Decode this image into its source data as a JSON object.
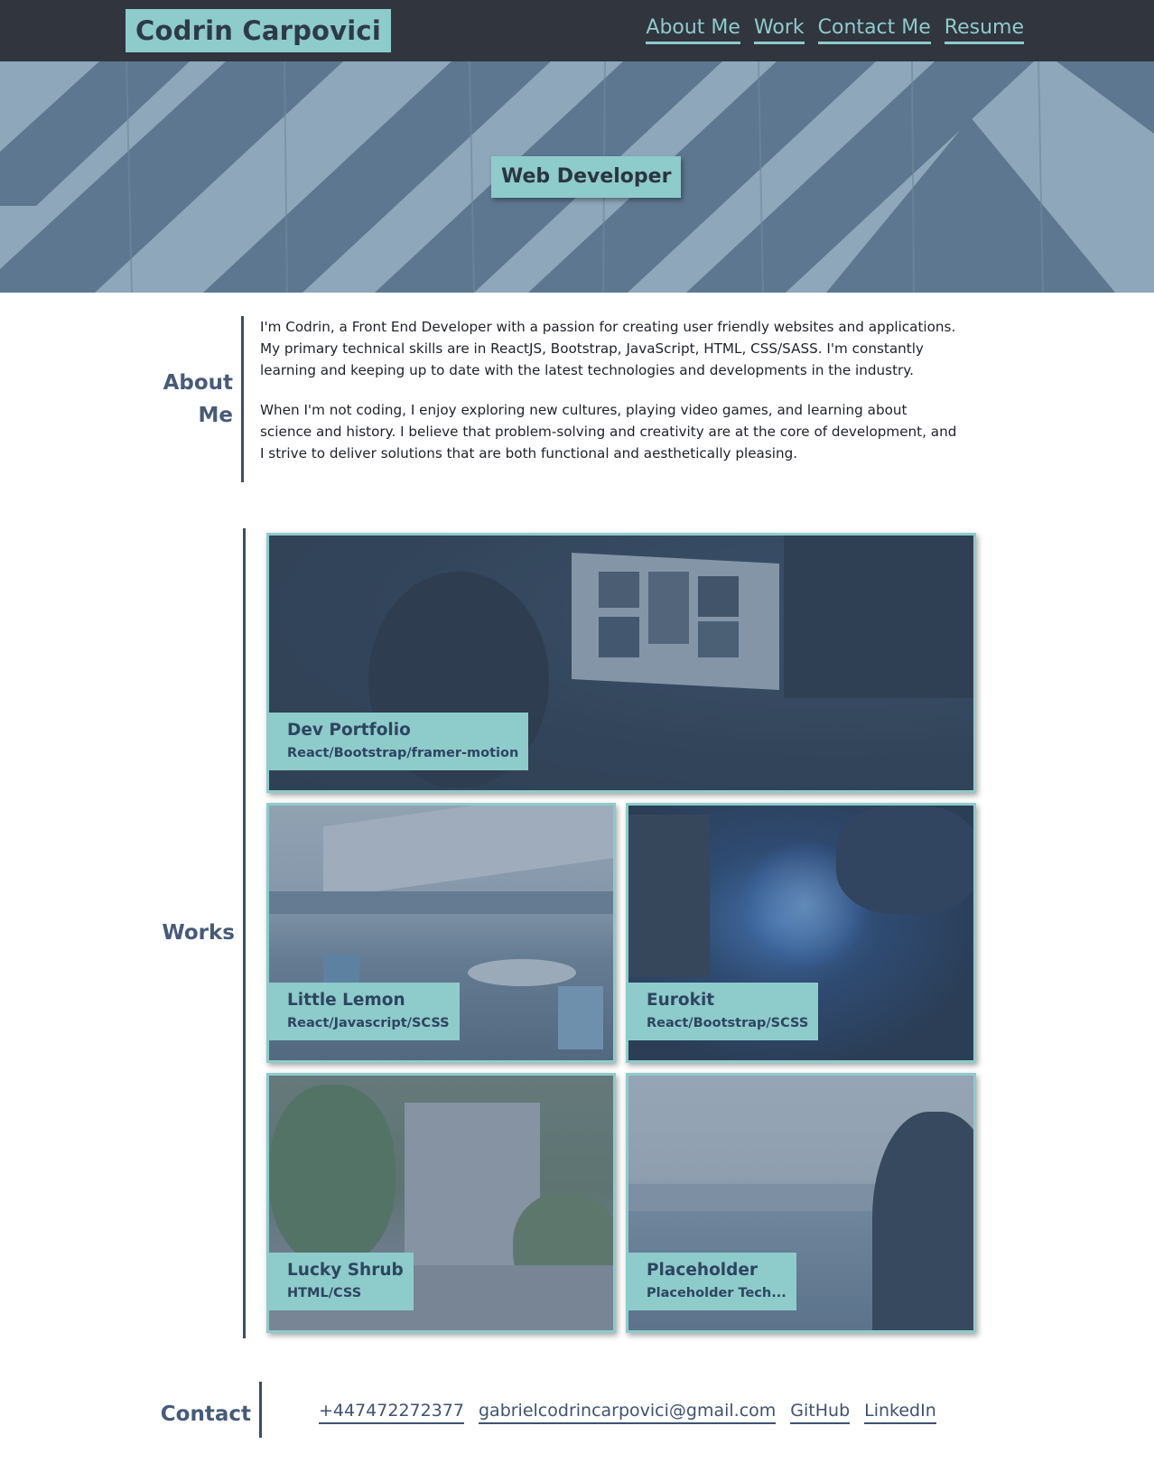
{
  "header": {
    "brand": "Codrin Carpovici",
    "nav": [
      "About Me",
      "Work",
      "Contact Me",
      "Resume"
    ]
  },
  "hero": {
    "badge": "Web Developer"
  },
  "about": {
    "title_line1": "About",
    "title_line2": "Me",
    "paragraphs": [
      "I'm Codrin, a Front End Developer with a passion for creating user friendly websites and applications. My primary technical skills are in ReactJS, Bootstrap, JavaScript, HTML, CSS/SASS. I'm constantly learning and keeping up to date with the latest technologies and developments in the industry.",
      "When I'm not coding, I enjoy exploring new cultures, playing video games, and learning about science and history. I believe that problem-solving and creativity are at the core of development, and I strive to deliver solutions that are both functional and aesthetically pleasing."
    ]
  },
  "works": {
    "title": "Works",
    "projects": [
      {
        "title": "Dev Portfolio",
        "tech": "React/Bootstrap/framer-motion"
      },
      {
        "title": "Little Lemon",
        "tech": "React/Javascript/SCSS"
      },
      {
        "title": "Eurokit",
        "tech": "React/Bootstrap/SCSS"
      },
      {
        "title": "Lucky Shrub",
        "tech": "HTML/CSS"
      },
      {
        "title": "Placeholder",
        "tech": "Placeholder Tech..."
      }
    ]
  },
  "contact": {
    "title": "Contact",
    "links": [
      "+447472272377",
      "gabrielcodrincarpovici@gmail.com",
      "GitHub",
      "LinkedIn"
    ]
  },
  "colors": {
    "header_bg": "#31353e",
    "accent": "#8ecbcb",
    "heading": "#475b79",
    "hero_bg": "#8ea7ba"
  }
}
